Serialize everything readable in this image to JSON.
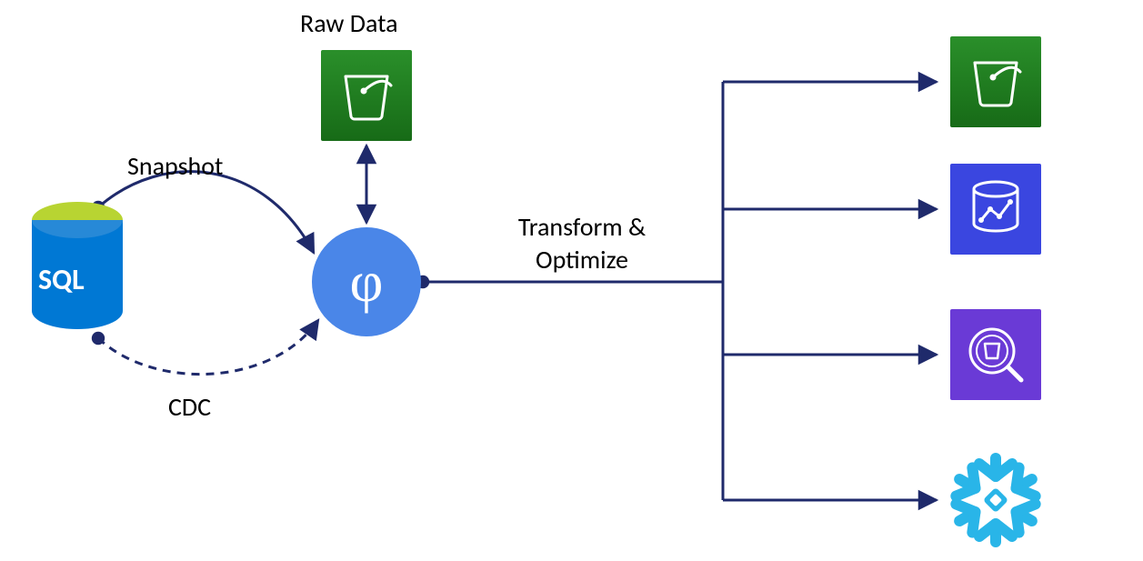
{
  "labels": {
    "raw_data": "Raw Data",
    "snapshot": "Snapshot",
    "cdc": "CDC",
    "transform_line1": "Transform &",
    "transform_line2": "Optimize",
    "sql": "SQL"
  },
  "nodes": {
    "source_db": {
      "name": "sql-database-icon",
      "label_key": "sql"
    },
    "phi": {
      "name": "phi-processor-icon",
      "glyph": "φ"
    },
    "raw_bucket": {
      "name": "s3-bucket-raw-icon"
    },
    "dest_bucket": {
      "name": "s3-bucket-dest-icon"
    },
    "dest_analytics": {
      "name": "analytics-service-icon"
    },
    "dest_athena": {
      "name": "athena-query-icon"
    },
    "dest_snowflake": {
      "name": "snowflake-icon"
    }
  },
  "edges": {
    "snapshot": {
      "from": "source_db",
      "to": "phi",
      "style": "solid",
      "label_key": "snapshot"
    },
    "cdc": {
      "from": "source_db",
      "to": "phi",
      "style": "dashed",
      "label_key": "cdc"
    },
    "raw": {
      "from": "phi",
      "to": "raw_bucket",
      "style": "solid-double-arrow",
      "label_key": "raw_data"
    },
    "transform": {
      "from": "phi",
      "to": [
        "dest_bucket",
        "dest_analytics",
        "dest_athena",
        "dest_snowflake"
      ],
      "style": "solid",
      "label_keys": [
        "transform_line1",
        "transform_line2"
      ]
    }
  },
  "colors": {
    "line": "#1f2a6b",
    "phi_fill": "#4a86e8",
    "green_tile": "#1e7e1e",
    "blue_tile": "#3a46e0",
    "purple_tile": "#6a3ad6",
    "snowflake": "#29b5e8",
    "sql_top": "#b8d432",
    "sql_body": "#0078d4"
  }
}
